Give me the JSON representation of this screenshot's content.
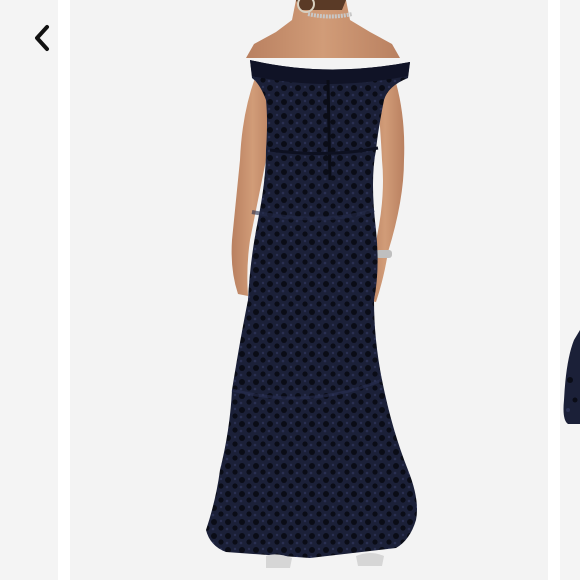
{
  "viewer": {
    "current_slide": 2,
    "background_color": "#f3f3f3"
  },
  "back_button": {
    "icon": "chevron-left-icon"
  },
  "main_image": {
    "subject": "model-wearing-off-shoulder-lace-mermaid-gown-back-view",
    "dress_color": "#161a2e",
    "lace_color": "#0c0e1a",
    "skin_color": "#c9936f"
  },
  "next_image": {
    "subject": "dark-lace-dress-partial"
  }
}
